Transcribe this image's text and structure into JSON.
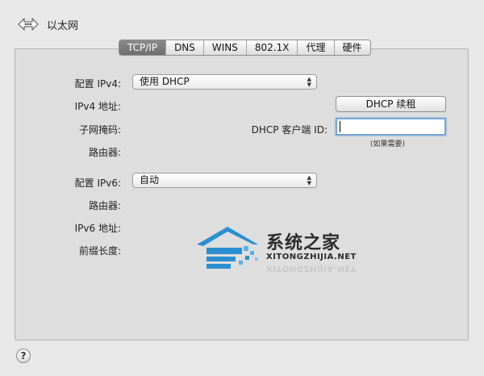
{
  "header": {
    "title": "以太网",
    "nav_icon": "back-forward-icon"
  },
  "tabs": [
    {
      "label": "TCP/IP",
      "active": true
    },
    {
      "label": "DNS"
    },
    {
      "label": "WINS"
    },
    {
      "label": "802.1X"
    },
    {
      "label": "代理"
    },
    {
      "label": "硬件"
    }
  ],
  "ipv4": {
    "config_label": "配置 IPv4:",
    "config_value": "使用 DHCP",
    "address_label": "IPv4 地址:",
    "subnet_label": "子网掩码:",
    "router_label": "路由器:",
    "renew_button": "DHCP 续租",
    "client_id_label": "DHCP 客户端 ID:",
    "client_id_value": "",
    "client_id_hint": "(如果需要)"
  },
  "ipv6": {
    "config_label": "配置 IPv6:",
    "config_value": "自动",
    "router_label": "路由器:",
    "address_label": "IPv6 地址:",
    "prefix_label": "前缀长度:"
  },
  "watermark": {
    "title": "系统之家",
    "subtitle": "XITONGZHIJIA.NET"
  },
  "help": {
    "label": "?"
  },
  "colors": {
    "accent": "#2a8fd0",
    "tab_active": "#7c7c7c"
  }
}
